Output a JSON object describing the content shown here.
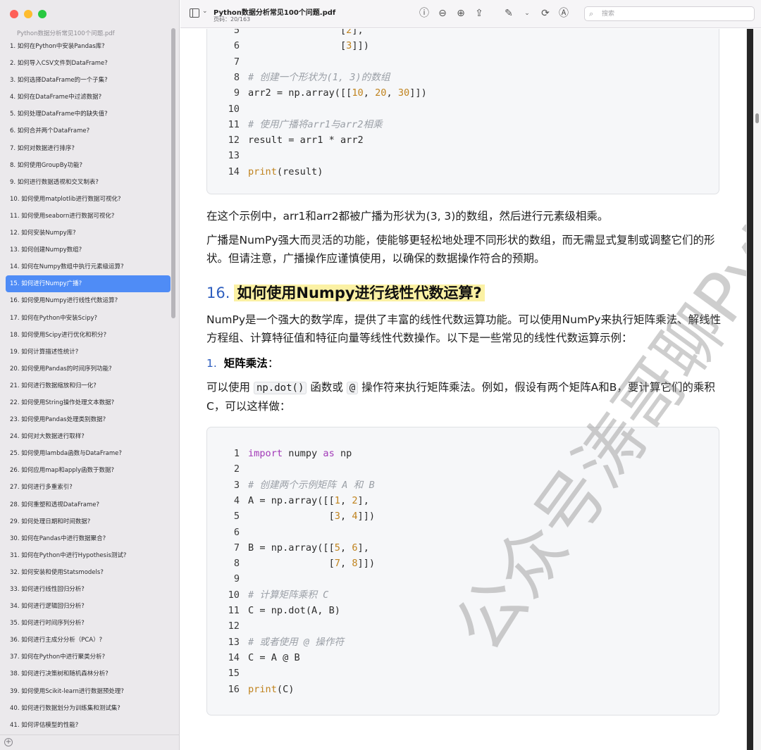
{
  "window": {
    "title": "Python数据分析常见100个问题.pdf",
    "page_info": "页码：20/163"
  },
  "search": {
    "placeholder": "搜索"
  },
  "sidebar": {
    "doc_title": "Python数据分析常见100个问题.pdf",
    "items": [
      "1. 如何在Python中安装Pandas库?",
      "2. 如何导入CSV文件到DataFrame?",
      "3. 如何选择DataFrame的一个子集?",
      "4. 如何在DataFrame中过滤数据?",
      "5. 如何处理DataFrame中的缺失值?",
      "6. 如何合并两个DataFrame?",
      "7. 如何对数据进行排序?",
      "8. 如何使用GroupBy功能?",
      "9. 如何进行数据透视和交叉制表?",
      "10. 如何使用matplotlib进行数据可视化?",
      "11. 如何使用seaborn进行数据可视化?",
      "12. 如何安装Numpy库?",
      "13. 如何创建Numpy数组?",
      "14. 如何在Numpy数组中执行元素级运算?",
      "15. 如何进行Numpy广播?",
      "16. 如何使用Numpy进行线性代数运算?",
      "17. 如何在Python中安装Scipy?",
      "18. 如何使用Scipy进行优化和积分?",
      "19. 如何计算描述性统计?",
      "20. 如何使用Pandas的时间序列功能?",
      "21. 如何进行数据缩放和归一化?",
      "22. 如何使用String操作处理文本数据?",
      "23. 如何使用Pandas处理类别数据?",
      "24. 如何对大数据进行取样?",
      "25. 如何使用lambda函数与DataFrame?",
      "26. 如何应用map和apply函数于数据?",
      "27. 如何进行多重索引?",
      "28. 如何重塑和透视DataFrame?",
      "29. 如何处理日期和时间数据?",
      "30. 如何在Pandas中进行数据聚合?",
      "31. 如何在Python中进行Hypothesis测试?",
      "32. 如何安装和使用Statsmodels?",
      "33. 如何进行线性回归分析?",
      "34. 如何进行逻辑回归分析?",
      "35. 如何进行时间序列分析?",
      "36. 如何进行主成分分析（PCA）?",
      "37. 如何在Python中进行聚类分析?",
      "38. 如何进行决策树和随机森林分析?",
      "39. 如何使用Scikit-learn进行数据预处理?",
      "40. 如何进行数据划分为训练集和测试集?",
      "41. 如何评估模型的性能?"
    ],
    "active_index": 14
  },
  "toolbar_icons": [
    "info-icon",
    "zoom-out-icon",
    "zoom-in-icon",
    "share-icon",
    "markup-pen-icon",
    "chevron-down-icon",
    "rotate-icon",
    "highlight-icon"
  ],
  "content": {
    "code_block_1": [
      {
        "n": "5",
        "code": "                [2],"
      },
      {
        "n": "6",
        "code": "                [3]])"
      },
      {
        "n": "7",
        "code": ""
      },
      {
        "n": "8",
        "code": "# 创建一个形状为(1, 3)的数组"
      },
      {
        "n": "9",
        "code": "arr2 = np.array([[10, 20, 30]])"
      },
      {
        "n": "10",
        "code": ""
      },
      {
        "n": "11",
        "code": "# 使用广播将arr1与arr2相乘"
      },
      {
        "n": "12",
        "code": "result = arr1 * arr2"
      },
      {
        "n": "13",
        "code": ""
      },
      {
        "n": "14",
        "code": "print(result)"
      }
    ],
    "para1": "在这个示例中，arr1和arr2都被广播为形状为(3, 3)的数组，然后进行元素级相乘。",
    "para2": "广播是NumPy强大而灵活的功能，使能够更轻松地处理不同形状的数组，而无需显式复制或调整它们的形状。但请注意，广播操作应谨慎使用，以确保的数据操作符合的预期。",
    "section_num": "16.",
    "section_title": "如何使用Numpy进行线性代数运算?",
    "para3": "NumPy是一个强大的数学库，提供了丰富的线性代数运算功能。可以使用NumPy来执行矩阵乘法、解线性方程组、计算特征值和特征向量等线性代数操作。以下是一些常见的线性代数运算示例：",
    "subhead_num": "1.",
    "subhead_title": "矩阵乘法",
    "subhead_colon": "：",
    "para4_a": "可以使用",
    "para4_code1": "np.dot()",
    "para4_b": "函数或",
    "para4_code2": "@",
    "para4_c": "操作符来执行矩阵乘法。例如，假设有两个矩阵A和B，要计算它们的乘积C，可以这样做：",
    "code_block_2": [
      {
        "n": "1",
        "code": "import numpy as np"
      },
      {
        "n": "2",
        "code": ""
      },
      {
        "n": "3",
        "code": "# 创建两个示例矩阵 A 和 B"
      },
      {
        "n": "4",
        "code": "A = np.array([[1, 2],"
      },
      {
        "n": "5",
        "code": "              [3, 4]])"
      },
      {
        "n": "6",
        "code": ""
      },
      {
        "n": "7",
        "code": "B = np.array([[5, 6],"
      },
      {
        "n": "8",
        "code": "              [7, 8]])"
      },
      {
        "n": "9",
        "code": ""
      },
      {
        "n": "10",
        "code": "# 计算矩阵乘积 C"
      },
      {
        "n": "11",
        "code": "C = np.dot(A, B)"
      },
      {
        "n": "12",
        "code": ""
      },
      {
        "n": "13",
        "code": "# 或者使用 @ 操作符"
      },
      {
        "n": "14",
        "code": "C = A @ B"
      },
      {
        "n": "15",
        "code": ""
      },
      {
        "n": "16",
        "code": "print(C)"
      }
    ]
  },
  "watermark": "公众号涛哥聊Python"
}
